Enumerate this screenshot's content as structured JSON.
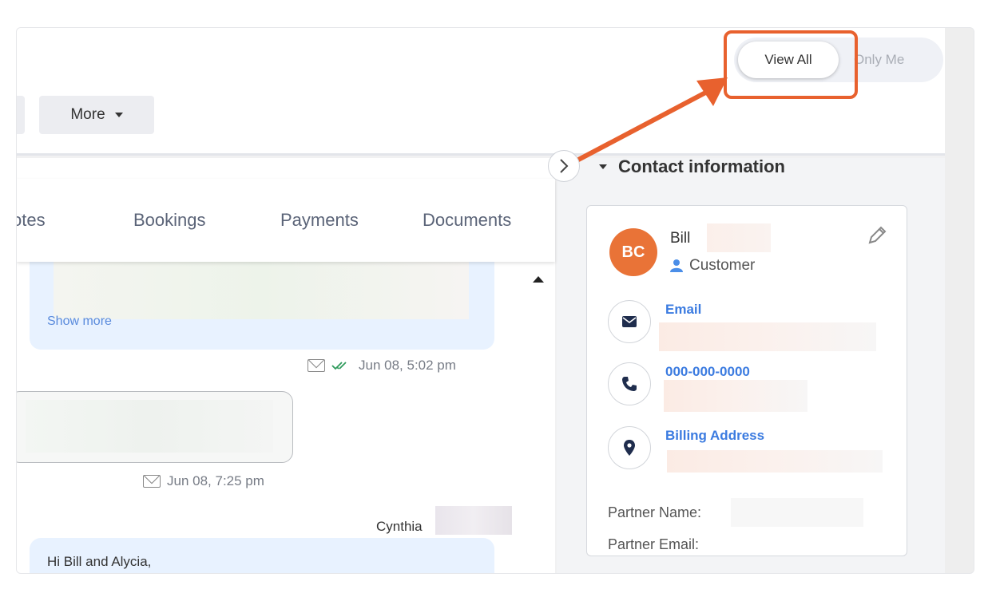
{
  "toolbar": {
    "more_label": "More",
    "view_all_label": "View All",
    "only_me_label": "Only Me"
  },
  "tabs": [
    {
      "label": "otes"
    },
    {
      "label": "Bookings"
    },
    {
      "label": "Payments"
    },
    {
      "label": "Documents"
    }
  ],
  "messages": {
    "show_more_label": "Show more",
    "msg1_time": "Jun 08, 5:02 pm",
    "msg2_time": "Jun 08, 7:25 pm",
    "sender_name": "Cynthia",
    "msg3_text": "Hi Bill and Alycia,"
  },
  "contact": {
    "section_title": "Contact information",
    "avatar_initials": "BC",
    "name": "Bill",
    "role": "Customer",
    "email_label": "Email",
    "phone_label": "000-000-0000",
    "address_label": "Billing Address",
    "partner_name_label": "Partner Name:",
    "partner_email_label": "Partner Email:"
  },
  "colors": {
    "accent_orange": "#e8612e",
    "avatar": "#e97337",
    "link_blue": "#3b7be0",
    "message_bg": "#e8f2ff"
  },
  "icons": [
    "caret-down-icon",
    "chevron-right-icon",
    "envelope-icon",
    "double-check-icon",
    "pencil-icon",
    "person-icon",
    "phone-icon",
    "location-pin-icon",
    "scroll-up-icon"
  ]
}
